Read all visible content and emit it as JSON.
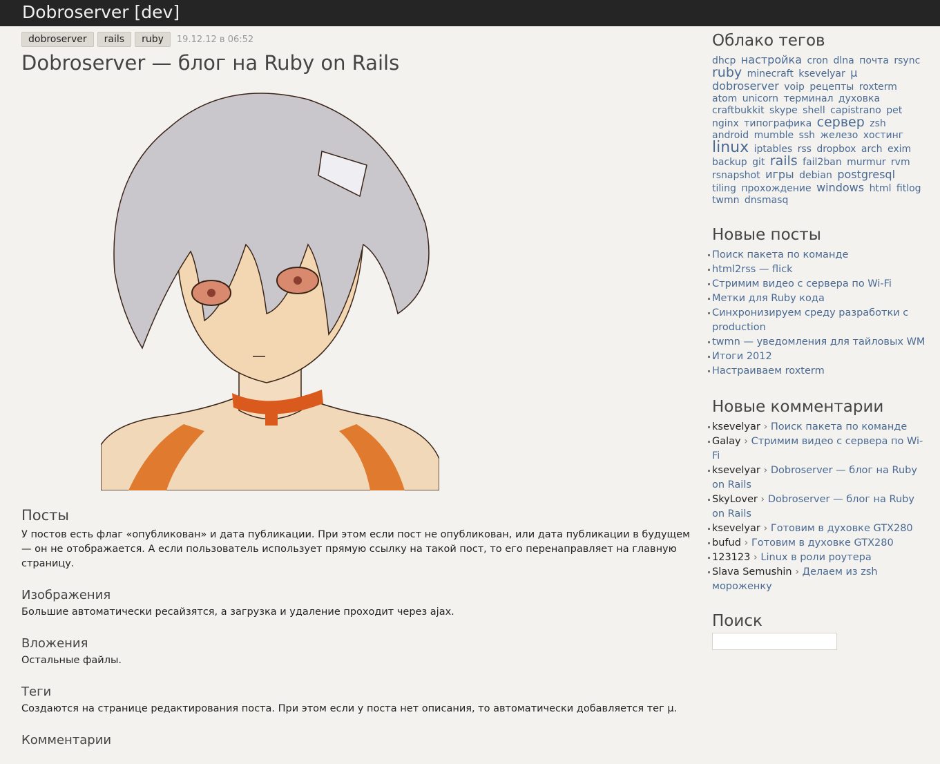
{
  "header": {
    "site_title": "Dobroserver [dev]"
  },
  "post": {
    "tags": [
      "dobroserver",
      "rails",
      "ruby"
    ],
    "date": "19.12.12 в 06:52",
    "title": "Dobroserver — блог на Ruby on Rails",
    "sections": [
      {
        "heading": "Посты",
        "text": "У постов есть флаг «опубликован» и дата публикации. При этом если пост не опубликован, или дата публикации в будущем — он не отображается. А если пользователь использует прямую ссылку на такой пост, то его перенаправляет на главную страницу."
      },
      {
        "heading": "Изображения",
        "text": "Большие автоматически ресайзятся, а загрузка и удаление проходит через ajax."
      },
      {
        "heading": "Вложения",
        "text": "Остальные файлы."
      },
      {
        "heading": "Теги",
        "text": "Создаются на странице редактирования поста. При этом если у поста нет описания, то автоматически добавляется тег μ."
      },
      {
        "heading": "Комментарии",
        "text": ""
      }
    ]
  },
  "sidebar": {
    "cloud_title": "Облако тегов",
    "cloud": [
      "dhcp",
      "настройка",
      "cron",
      "dlna",
      "почта",
      "rsync",
      "ruby",
      "minecraft",
      "ksevelyar",
      "μ",
      "dobroserver",
      "voip",
      "рецепты",
      "roxterm",
      "atom",
      "unicorn",
      "терминал",
      "духовка",
      "craftbukkit",
      "skype",
      "shell",
      "capistrano",
      "pet",
      "nginx",
      "типографика",
      "сервер",
      "zsh",
      "android",
      "mumble",
      "ssh",
      "железо",
      "хостинг",
      "linux",
      "iptables",
      "rss",
      "dropbox",
      "arch",
      "exim",
      "backup",
      "git",
      "rails",
      "fail2ban",
      "murmur",
      "rvm",
      "rsnapshot",
      "игры",
      "debian",
      "postgresql",
      "tiling",
      "прохождение",
      "windows",
      "html",
      "fitlog",
      "twmn",
      "dnsmasq"
    ],
    "posts_title": "Новые посты",
    "posts": [
      "Поиск пакета по команде",
      "html2rss — flick",
      "Стримим видео с сервера по Wi-Fi",
      "Метки для Ruby кода",
      "Синхронизируем среду разработки с production",
      "twmn — уведомления для тайловых WM",
      "Итоги 2012",
      "Настраиваем roxterm"
    ],
    "comments_title": "Новые комментарии",
    "comments": [
      {
        "author": "ksevelyar",
        "post": "Поиск пакета по команде"
      },
      {
        "author": "Galay",
        "post": "Стримим видео с сервера по Wi-Fi"
      },
      {
        "author": "ksevelyar",
        "post": "Dobroserver — блог на Ruby on Rails"
      },
      {
        "author": "SkyLover",
        "post": "Dobroserver — блог на Ruby on Rails"
      },
      {
        "author": "ksevelyar",
        "post": "Готовим в духовке GTX280"
      },
      {
        "author": "bufud",
        "post": "Готовим в духовке GTX280"
      },
      {
        "author": "123123",
        "post": "Linux в роли роутера"
      },
      {
        "author": "Slava Semushin",
        "post": "Делаем из zsh мороженку"
      }
    ],
    "comment_separator": "›",
    "search_title": "Поиск",
    "search_value": ""
  }
}
